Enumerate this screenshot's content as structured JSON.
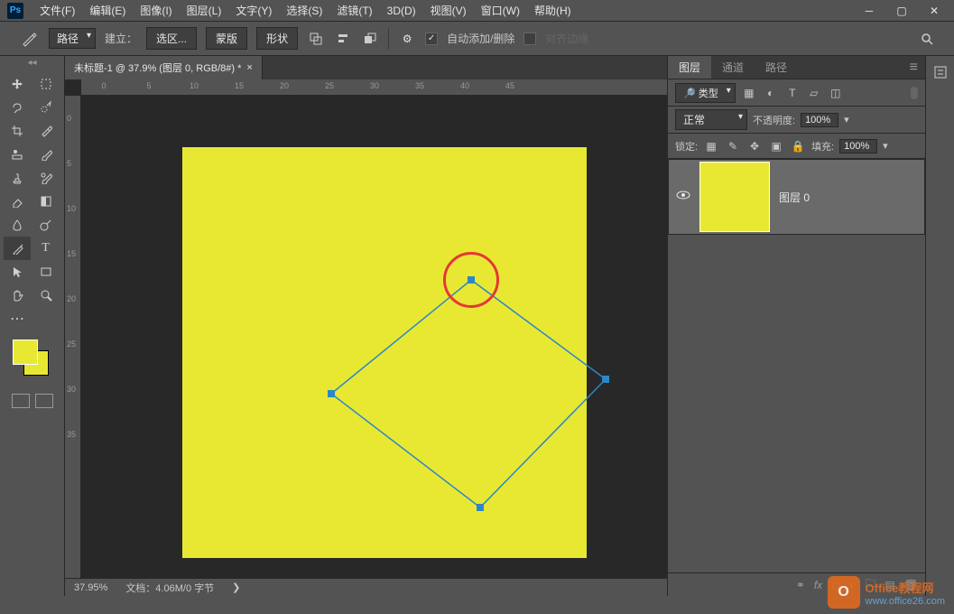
{
  "menu": {
    "file": "文件(F)",
    "edit": "编辑(E)",
    "image": "图像(I)",
    "layer": "图层(L)",
    "type": "文字(Y)",
    "select": "选择(S)",
    "filter": "滤镜(T)",
    "three_d": "3D(D)",
    "view": "视图(V)",
    "window": "窗口(W)",
    "help": "帮助(H)"
  },
  "options": {
    "tool_mode": "路径",
    "create_label": "建立：",
    "selection": "选区...",
    "mask": "蒙版",
    "shape": "形状",
    "auto_add_delete": "自动添加/删除",
    "align_edges": "对齐边缘"
  },
  "document": {
    "tab_title": "未标题-1 @ 37.9% (图层 0, RGB/8#) *"
  },
  "ruler_h": [
    "0",
    "5",
    "10",
    "15",
    "20",
    "25",
    "30",
    "35",
    "40",
    "45"
  ],
  "ruler_v": [
    "0",
    "5",
    "10",
    "15",
    "20",
    "25",
    "30",
    "35"
  ],
  "status": {
    "zoom": "37.95%",
    "doc_info": "文档：4.06M/0 字节"
  },
  "panels": {
    "layers_tab": "图层",
    "channels_tab": "通道",
    "paths_tab": "路径",
    "filter_type": "类型",
    "blend_mode": "正常",
    "opacity_label": "不透明度:",
    "opacity_value": "100%",
    "lock_label": "锁定:",
    "fill_label": "填充:",
    "fill_value": "100%",
    "layer0_name": "图层 0"
  },
  "icons": {
    "ps": "Ps",
    "search": "🔍",
    "eye": "👁",
    "close": "×",
    "chevron": "❯",
    "menu": "≡"
  },
  "watermark": {
    "logo": "O",
    "title": "Office教程网",
    "url": "www.office26.com"
  }
}
